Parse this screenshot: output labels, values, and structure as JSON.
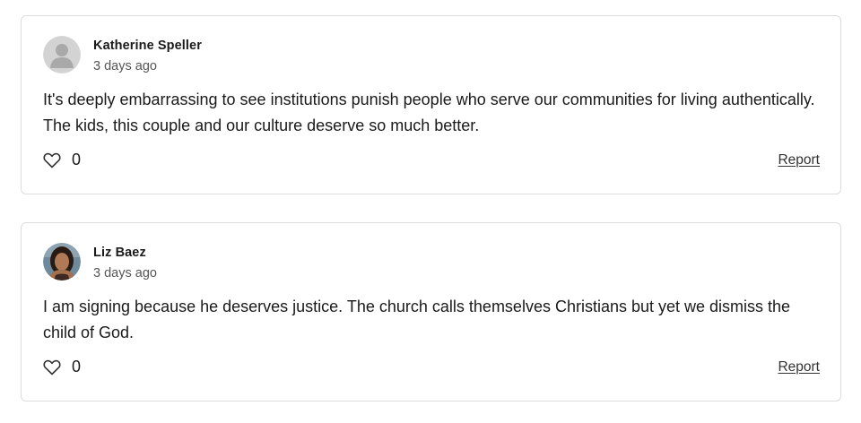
{
  "comments": [
    {
      "author": "Katherine Speller",
      "time": "3 days ago",
      "text": "It's deeply embarrassing to see institutions punish people who serve our communities for living authentically. The kids, this couple and our culture deserve so much better.",
      "likes": "0",
      "report_label": "Report",
      "avatar": "default-avatar-icon"
    },
    {
      "author": "Liz Baez",
      "time": "3 days ago",
      "text": "I am signing because he deserves justice. The church calls themselves Christians but yet we dismiss the child of God.",
      "likes": "0",
      "report_label": "Report",
      "avatar": "user-photo"
    }
  ],
  "colors": {
    "border": "#dcdcdc",
    "text": "#1a1a1a",
    "muted": "#555555"
  }
}
